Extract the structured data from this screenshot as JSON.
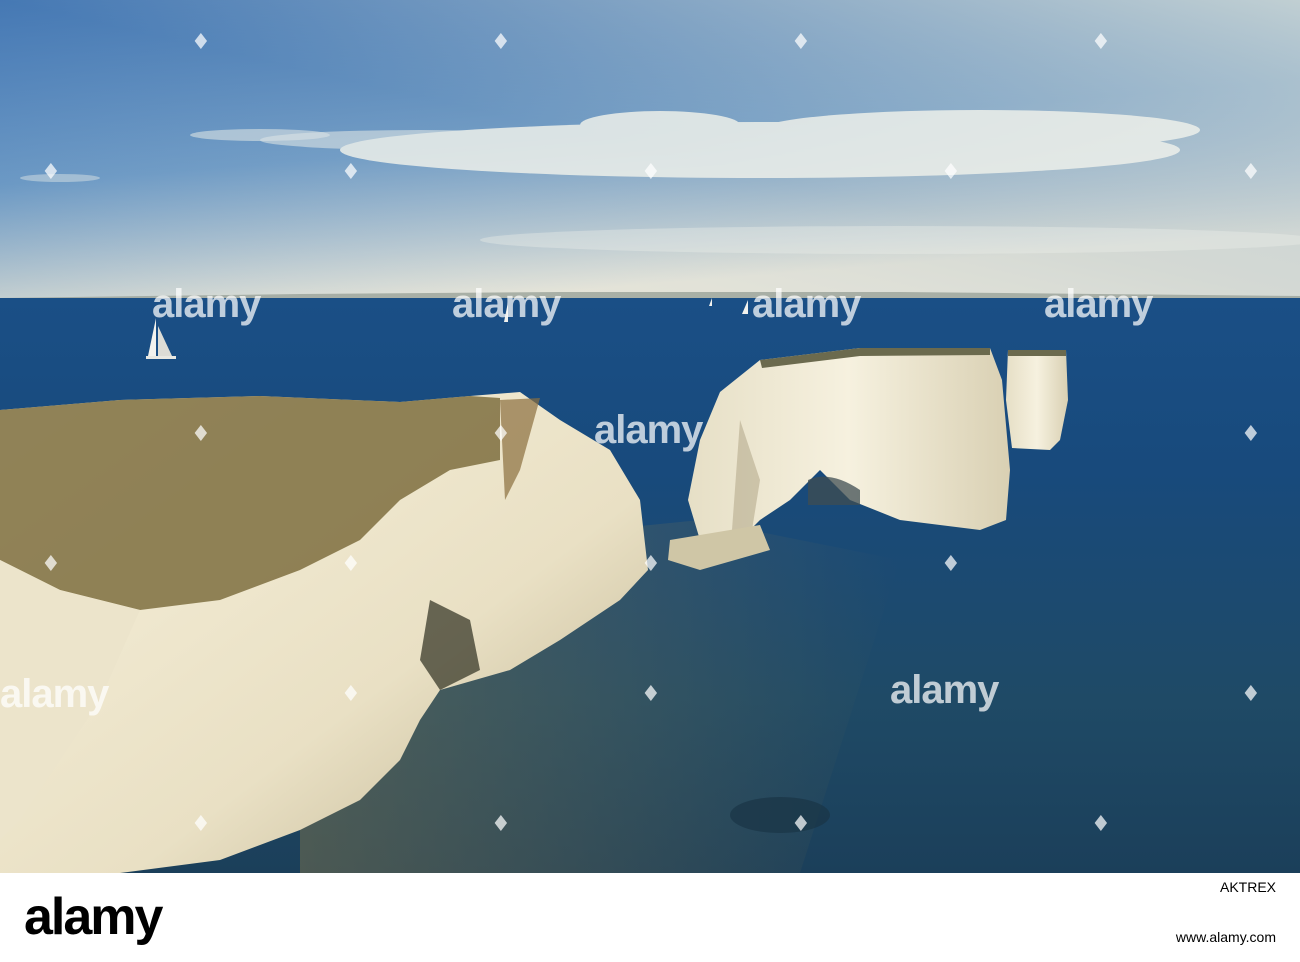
{
  "scene": {
    "description_colors": {
      "sky_top": "#1a5aa8",
      "sky_horizon": "#e8e6d6",
      "sea_deep": "#123f73",
      "sea_near": "#2a4f66",
      "chalk": "#f1ead6",
      "grass": "#7a6a3a"
    }
  },
  "watermark": {
    "text": "alamy",
    "icon": "alamy-a-icon"
  },
  "footer": {
    "logo": "alamy",
    "image_id": "AKTREX",
    "url": "www.alamy.com"
  }
}
